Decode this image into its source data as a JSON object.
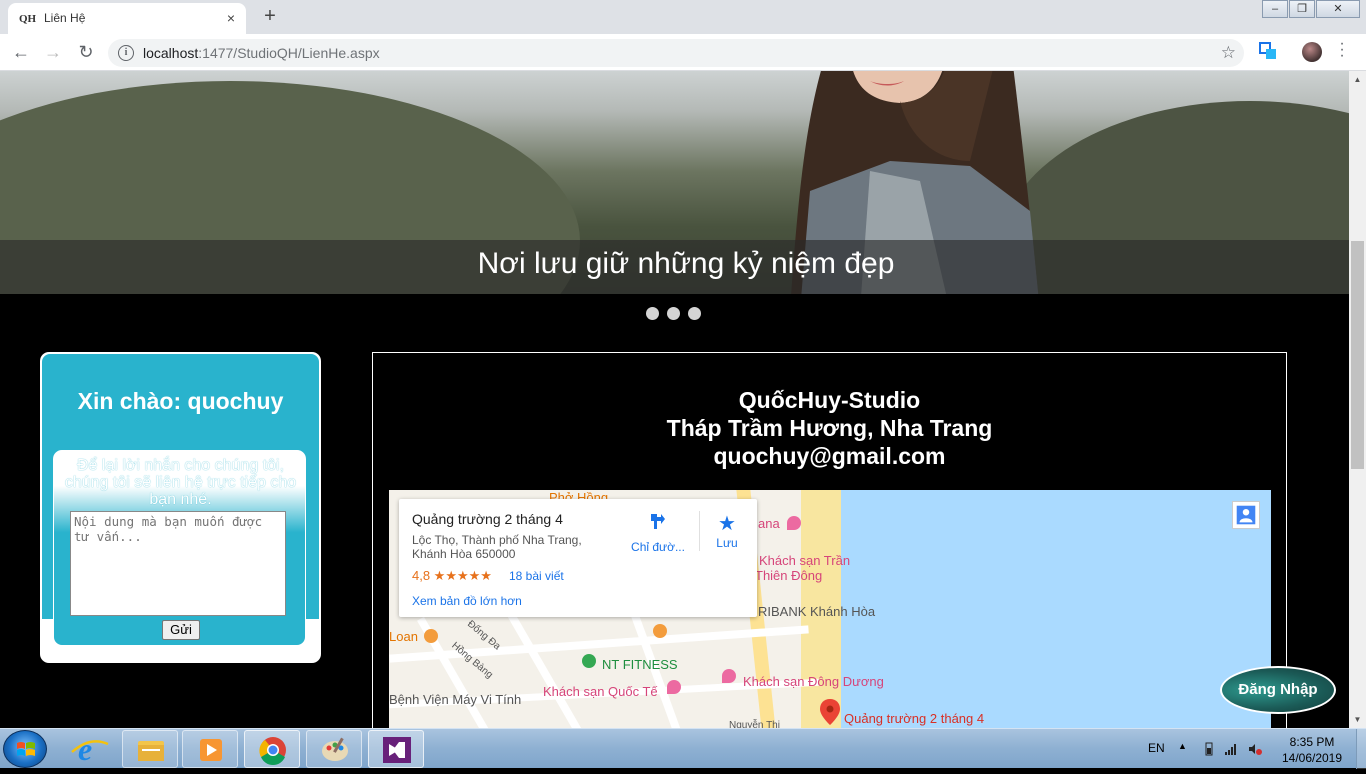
{
  "browser": {
    "tab_title": "Liên Hệ",
    "tab_favicon": "QH",
    "new_tab": "+",
    "close_tab": "×",
    "url_host": "localhost",
    "url_path": ":1477/StudioQH/LienHe.aspx"
  },
  "slider": {
    "caption": "Nơi lưu giữ những kỷ niệm đẹp",
    "dot_count": 3
  },
  "greeting": {
    "title": "Xin chào: quochuy",
    "instructions": "Để lại lời nhắn cho chúng tôi, chúng tôi sẽ liên hệ trực tiếp cho bạn nhé.",
    "textarea_placeholder": "Nội dung mà bạn muốn được tư vấn...",
    "send_label": "Gửi"
  },
  "studio": {
    "name": "QuốcHuy-Studio",
    "address": "Tháp Trầm Hương, Nha Trang",
    "email": "quochuy@gmail.com"
  },
  "map": {
    "place_title": "Quảng trường 2 tháng 4",
    "place_address": "Lộc Thọ, Thành phố Nha Trang, Khánh Hòa 650000",
    "rating": "4,8 ★★★★★",
    "reviews": "18 bài viết",
    "larger_map": "Xem bản đồ lớn hơn",
    "directions_label": "Chỉ đườ...",
    "save_label": "Lưu",
    "labels": {
      "pho_hong": "Phở Hồng",
      "khach_san_tran": "Khách sạn Trần",
      "thien_dong": "Thiên Đông",
      "agribank": "RIBANK Khánh Hòa",
      "nt_fitness": "NT FITNESS",
      "khach_san_dong_duong": "Khách sạn Đông Dương",
      "khach_san_quoc_te": "Khách sạn Quốc Tế",
      "benh_vien": "Bệnh Viện Máy Vi Tính",
      "loan": "Loan",
      "ana": "ana",
      "hong_bang": "Hồng Bàng",
      "dong_da": "Đống Đa",
      "nguyen_thi": "Nguyễn Thị",
      "pin_label": "Quảng trường 2 tháng 4"
    }
  },
  "login_label": "Đăng Nhập",
  "taskbar": {
    "lang": "EN",
    "time": "8:35 PM",
    "date": "14/06/2019"
  },
  "colors": {
    "card_accent": "#29b3cd",
    "login_bg": "#1b5b57",
    "page_bg": "#000000"
  }
}
